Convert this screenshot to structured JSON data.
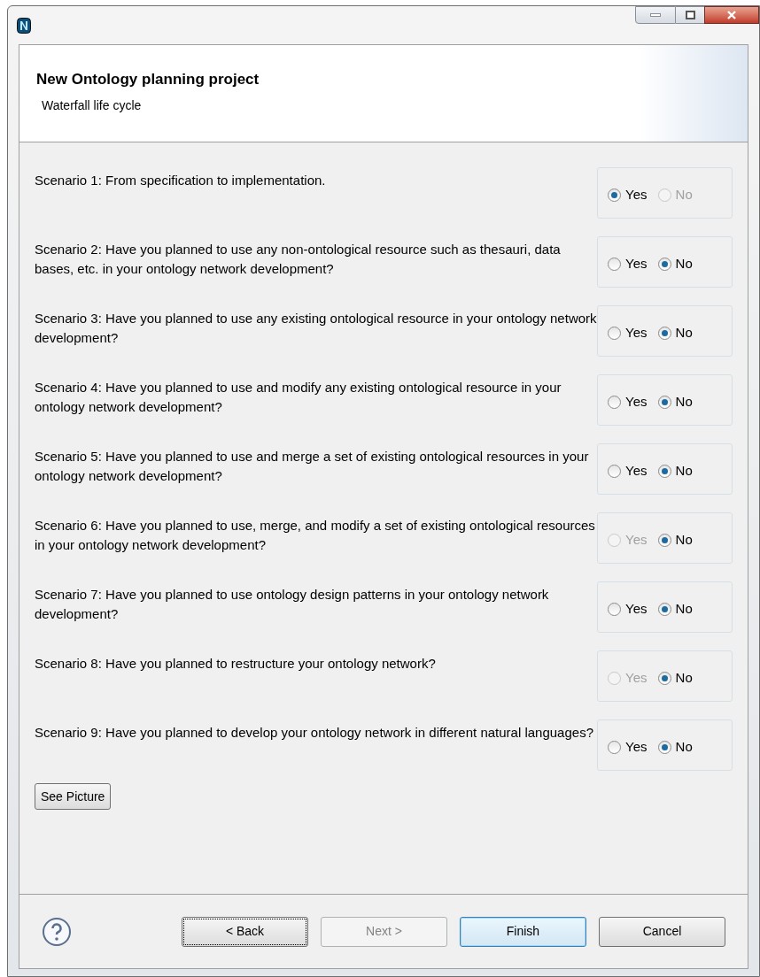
{
  "window": {
    "title": "New Ontology planning project",
    "subtitle": "Waterfall life cycle"
  },
  "scenarios": [
    {
      "question": "Scenario 1: From specification to implementation.",
      "options": [
        {
          "label": "Yes",
          "selected": true,
          "disabled": false
        },
        {
          "label": "No",
          "selected": false,
          "disabled": true
        }
      ]
    },
    {
      "question": "Scenario 2: Have you planned to use any non-ontological resource such as thesauri, data bases, etc. in your ontology network development?",
      "options": [
        {
          "label": "Yes",
          "selected": false,
          "disabled": false
        },
        {
          "label": "No",
          "selected": true,
          "disabled": false
        }
      ]
    },
    {
      "question": "Scenario 3: Have you planned to use any existing ontological resource in your ontology network development?",
      "options": [
        {
          "label": "Yes",
          "selected": false,
          "disabled": false
        },
        {
          "label": "No",
          "selected": true,
          "disabled": false
        }
      ]
    },
    {
      "question": "Scenario 4: Have you planned to use and modify any existing ontological resource in your ontology network development?",
      "options": [
        {
          "label": "Yes",
          "selected": false,
          "disabled": false
        },
        {
          "label": "No",
          "selected": true,
          "disabled": false
        }
      ]
    },
    {
      "question": "Scenario 5: Have you planned to use and merge a set of existing ontological resources in your ontology network development?",
      "options": [
        {
          "label": "Yes",
          "selected": false,
          "disabled": false
        },
        {
          "label": "No",
          "selected": true,
          "disabled": false
        }
      ]
    },
    {
      "question": "Scenario 6: Have you planned to use, merge, and modify a set of existing ontological resources in your ontology network development?",
      "options": [
        {
          "label": "Yes",
          "selected": false,
          "disabled": true
        },
        {
          "label": "No",
          "selected": true,
          "disabled": false
        }
      ]
    },
    {
      "question": "Scenario 7: Have you planned to use ontology design patterns in your ontology network development?",
      "options": [
        {
          "label": "Yes",
          "selected": false,
          "disabled": false
        },
        {
          "label": "No",
          "selected": true,
          "disabled": false
        }
      ]
    },
    {
      "question": "Scenario 8: Have you planned to restructure your ontology network?",
      "options": [
        {
          "label": "Yes",
          "selected": false,
          "disabled": true
        },
        {
          "label": "No",
          "selected": true,
          "disabled": false
        }
      ]
    },
    {
      "question": "Scenario 9: Have you planned to develop your ontology network in different natural languages?",
      "options": [
        {
          "label": "Yes",
          "selected": false,
          "disabled": false
        },
        {
          "label": "No",
          "selected": true,
          "disabled": false
        }
      ]
    }
  ],
  "see_picture_button": "See Picture",
  "buttons": [
    {
      "label": "< Back",
      "kind": "focused",
      "disabled": false
    },
    {
      "label": "Next >",
      "kind": "normal",
      "disabled": true
    },
    {
      "label": "Finish",
      "kind": "default",
      "disabled": false
    },
    {
      "label": "Cancel",
      "kind": "normal",
      "disabled": false
    }
  ]
}
